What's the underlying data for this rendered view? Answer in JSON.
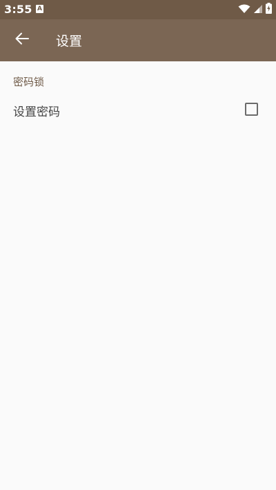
{
  "status_bar": {
    "time": "3:55",
    "notification_badge": "A",
    "icons": [
      "wifi-icon",
      "signal-icon",
      "battery-charging-icon"
    ]
  },
  "app_bar": {
    "back_icon": "arrow-back-icon",
    "title": "设置"
  },
  "content": {
    "section_header": "密码锁",
    "preference": {
      "title": "设置密码",
      "checked": false
    }
  },
  "colors": {
    "status_bar": "#6f5a47",
    "app_bar": "#7b6654",
    "accent": "#6f5a47",
    "background": "#fafafa"
  }
}
